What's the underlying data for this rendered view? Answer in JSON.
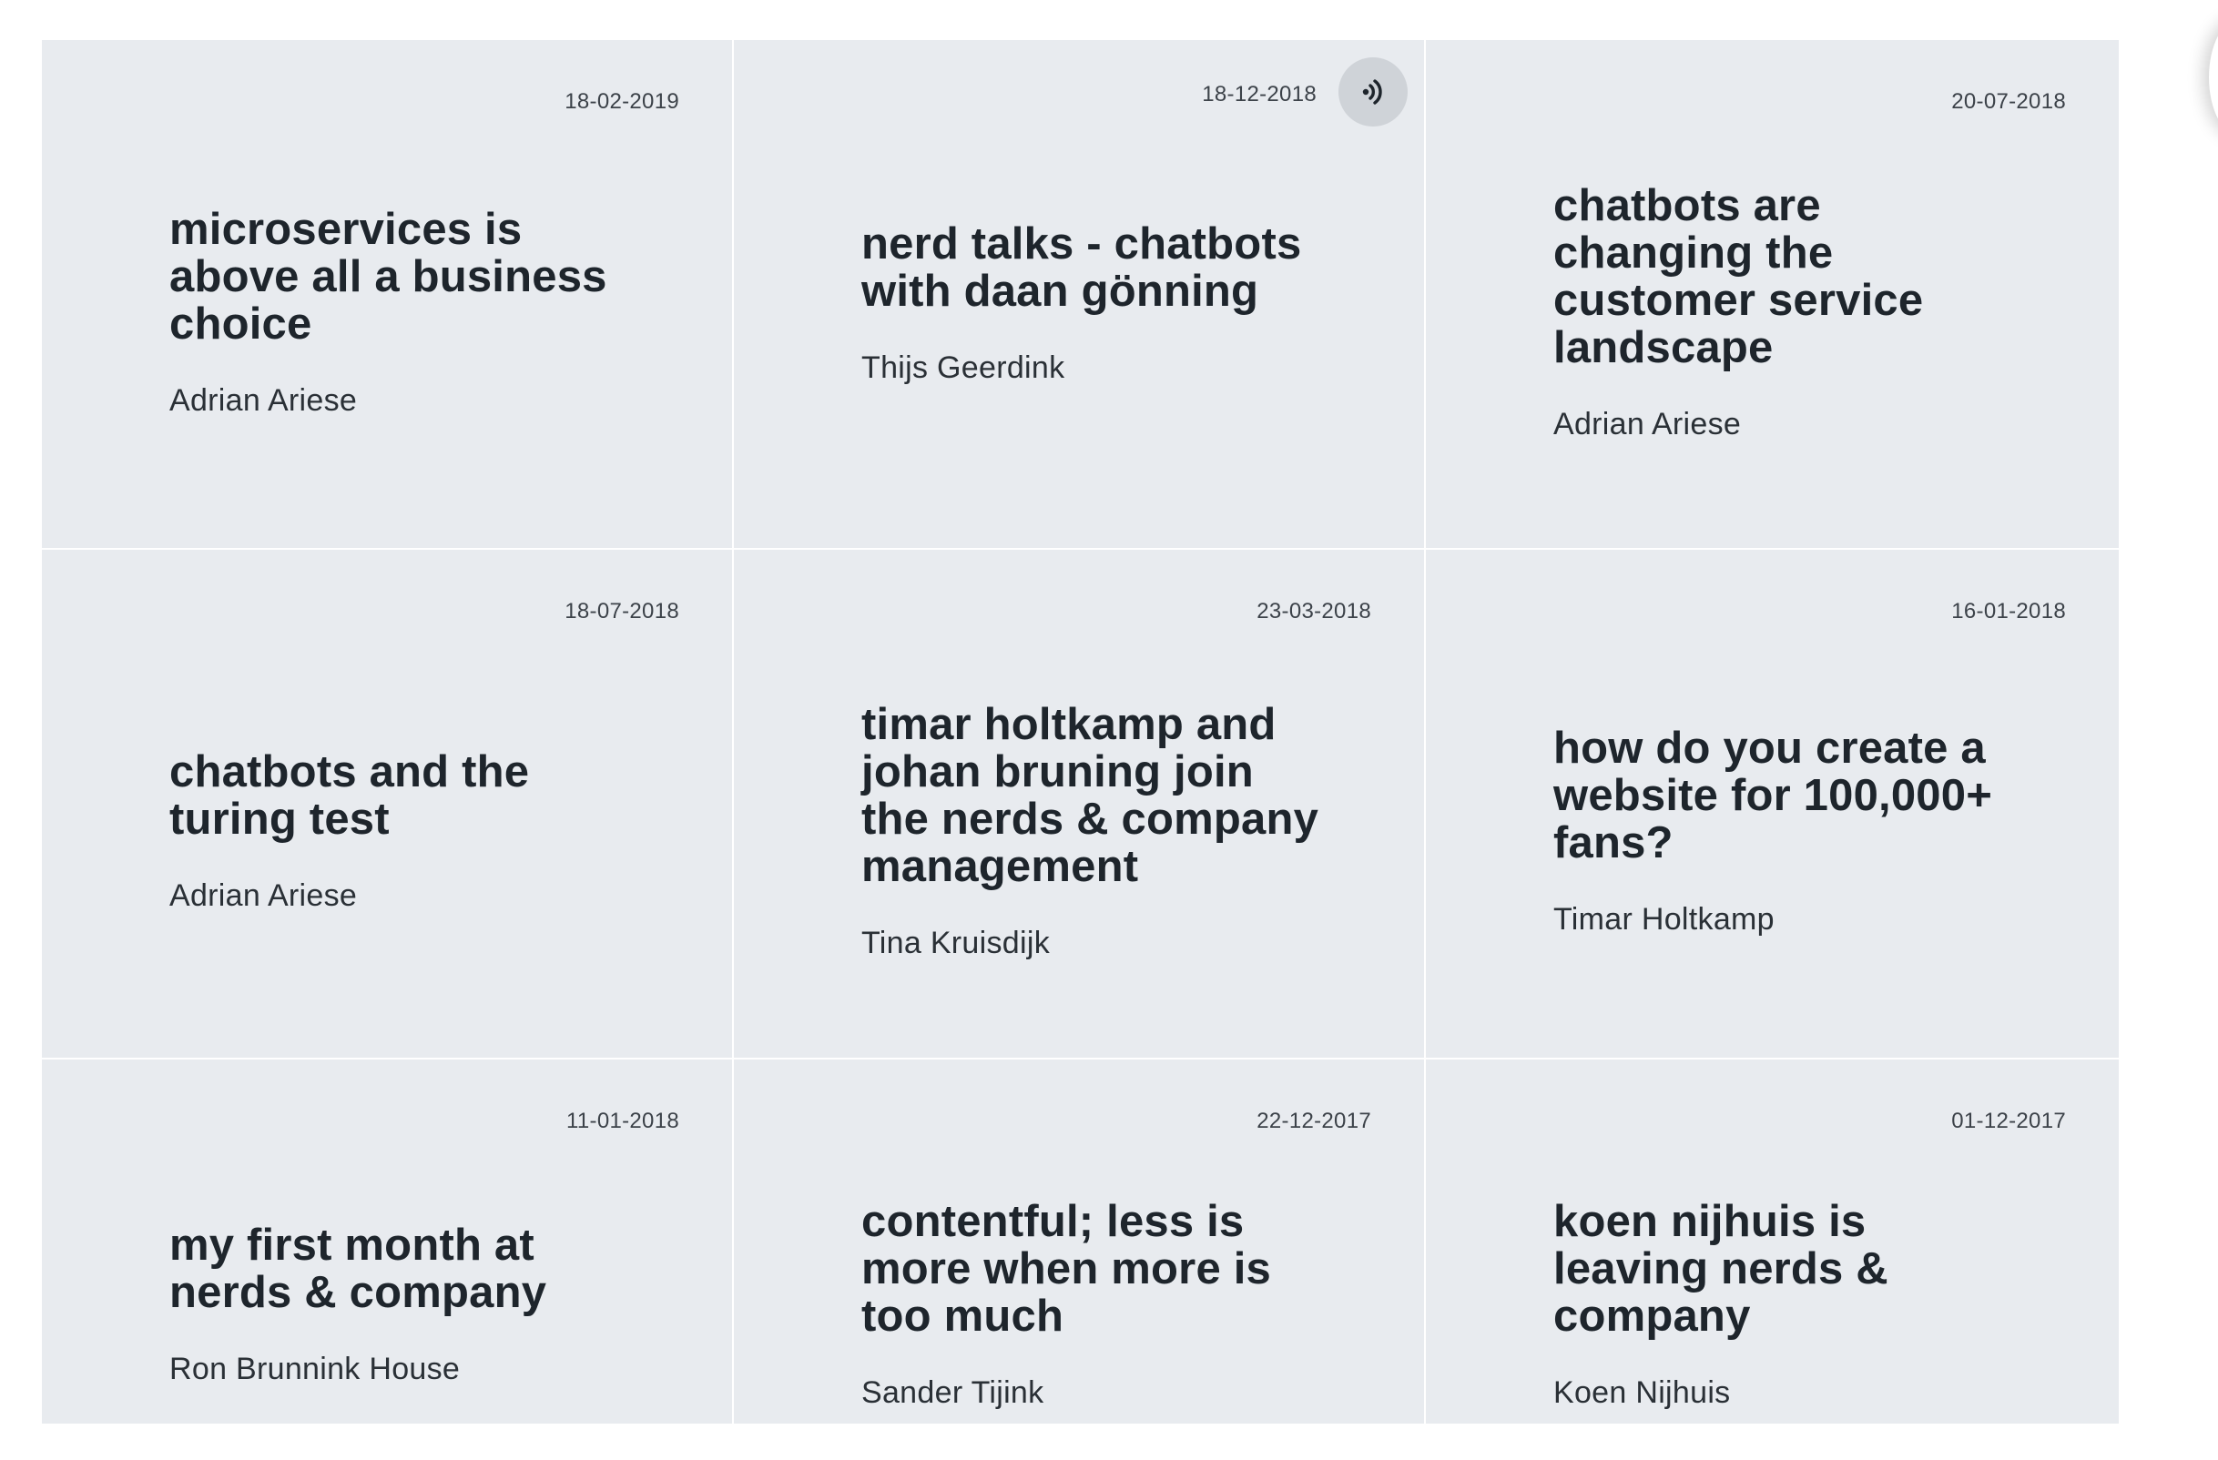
{
  "cards": [
    {
      "date": "18-02-2019",
      "title": "microservices is above all a business choice",
      "author": "Adrian Ariese"
    },
    {
      "date": "18-12-2018",
      "title": "nerd talks - chatbots with daan gönning",
      "author": "Thijs Geerdink",
      "icon": "podcast-audio-icon"
    },
    {
      "date": "20-07-2018",
      "title": "chatbots are changing the customer service landscape",
      "author": "Adrian Ariese"
    },
    {
      "date": "18-07-2018",
      "title": "chatbots and the turing test",
      "author": "Adrian Ariese"
    },
    {
      "date": "23-03-2018",
      "title": "timar holtkamp and johan bruning join the nerds & company management",
      "author": "Tina Kruisdijk"
    },
    {
      "date": "16-01-2018",
      "title": "how do you create a website for 100,000+ fans?",
      "author": "Timar Holtkamp"
    },
    {
      "date": "11-01-2018",
      "title": "my first month at nerds & company",
      "author": "Ron Brunnink House"
    },
    {
      "date": "22-12-2017",
      "title": "contentful; less is more when more is too much",
      "author": "Sander Tijink"
    },
    {
      "date": "01-12-2017",
      "title": "koen nijhuis is leaving nerds & company",
      "author": "Koen Nijhuis"
    }
  ],
  "colors": {
    "card_bg": "#e8ebef",
    "title": "#1e252c",
    "text": "#2a3036",
    "badge_bg": "#cfd3d8"
  }
}
